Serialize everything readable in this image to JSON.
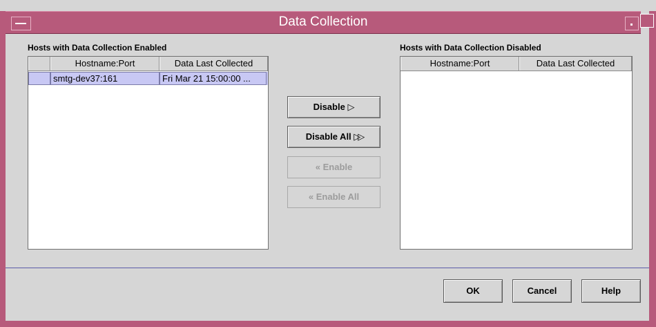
{
  "window": {
    "title": "Data Collection"
  },
  "enabled_panel": {
    "label": "Hosts with Data Collection Enabled",
    "columns": [
      "Hostname:Port",
      "Data Last Collected"
    ],
    "rows": [
      {
        "host": "smtg-dev37:161",
        "last": "Fri Mar 21 15:00:00 ..."
      }
    ]
  },
  "disabled_panel": {
    "label": "Hosts with Data Collection Disabled",
    "columns": [
      "Hostname:Port",
      "Data Last Collected"
    ],
    "rows": []
  },
  "actions": {
    "disable": "Disable",
    "disable_all": "Disable All",
    "enable": "Enable",
    "enable_all": "Enable All"
  },
  "footer": {
    "ok": "OK",
    "cancel": "Cancel",
    "help": "Help"
  },
  "icons": {
    "single_right": "single-chevron-right-icon",
    "double_right": "double-chevron-right-icon",
    "single_left": "single-chevron-left-icon",
    "double_left": "double-chevron-left-icon"
  },
  "colors": {
    "titlebar": "#b75a7b",
    "selection": "#c8c8f4",
    "background": "#d6d6d6"
  }
}
